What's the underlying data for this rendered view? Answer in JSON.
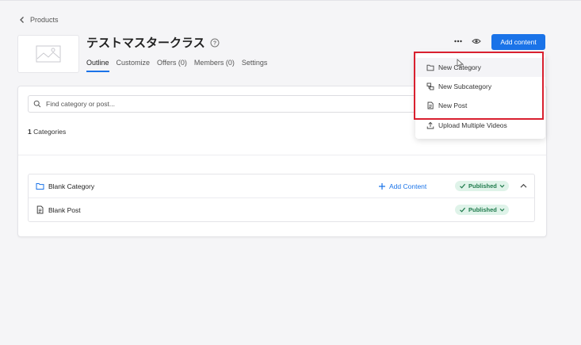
{
  "breadcrumb": {
    "label": "Products"
  },
  "course": {
    "title": "テストマスタークラス"
  },
  "tabs": [
    {
      "label": "Outline",
      "active": true
    },
    {
      "label": "Customize"
    },
    {
      "label": "Offers (0)"
    },
    {
      "label": "Members (0)"
    },
    {
      "label": "Settings"
    }
  ],
  "toolbar": {
    "add_content_label": "Add content"
  },
  "search": {
    "placeholder": "Find category or post..."
  },
  "summary": {
    "count": "1",
    "label": "Categories"
  },
  "outline": {
    "category": {
      "name": "Blank Category",
      "add_label": "Add Content",
      "status": "Published"
    },
    "post": {
      "name": "Blank Post",
      "status": "Published"
    }
  },
  "menu": {
    "items": [
      {
        "label": "New Category"
      },
      {
        "label": "New Subcategory"
      },
      {
        "label": "New Post"
      },
      {
        "label": "Upload Multiple Videos"
      }
    ]
  },
  "colors": {
    "accent": "#1a73e8",
    "published_bg": "#dff3e9",
    "published_text": "#1f7a4c",
    "highlight": "#d9202f"
  },
  "icons": [
    "chevron-left-icon",
    "image-placeholder-icon",
    "help-circle-icon",
    "more-dots-icon",
    "eye-icon",
    "search-icon",
    "folder-icon",
    "document-icon",
    "subcategory-icon",
    "upload-icon",
    "plus-icon",
    "check-icon",
    "chevron-down-icon",
    "chevron-up-icon",
    "cursor-icon"
  ]
}
